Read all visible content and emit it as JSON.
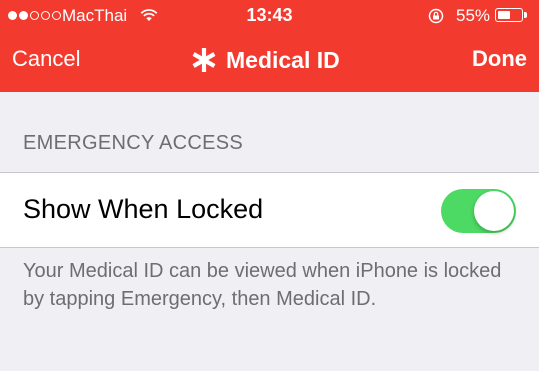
{
  "status_bar": {
    "carrier": "MacThai",
    "time": "13:43",
    "battery_percent": "55%",
    "battery_level": 0.55,
    "signal_bars_filled": 2,
    "signal_bars_total": 5
  },
  "nav": {
    "cancel_label": "Cancel",
    "title": "Medical ID",
    "done_label": "Done"
  },
  "section": {
    "header": "EMERGENCY ACCESS"
  },
  "row": {
    "label": "Show When Locked",
    "toggle_on": true
  },
  "footer_text": "Your Medical ID can be viewed when iPhone is locked by tapping Emergency, then Medical ID.",
  "colors": {
    "accent": "#f33a2f",
    "toggle_on": "#4cd964"
  }
}
